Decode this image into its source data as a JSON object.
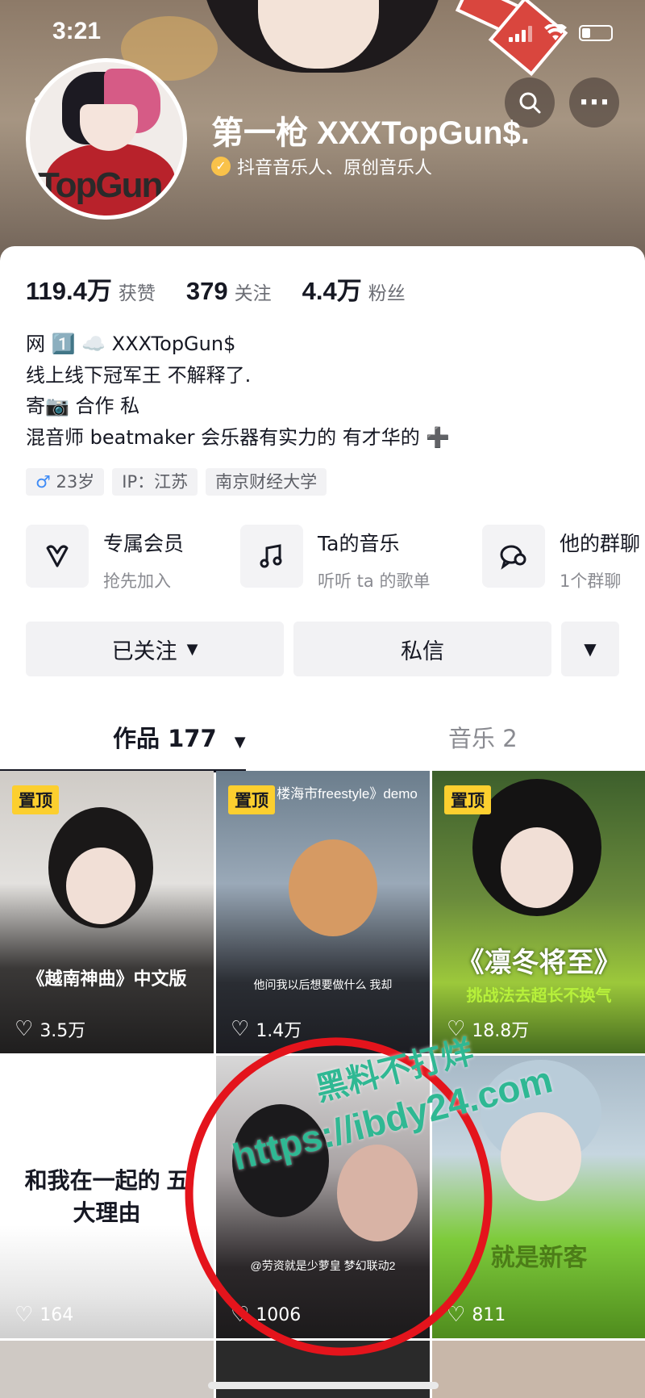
{
  "status_bar": {
    "time": "3:21"
  },
  "profile": {
    "nickname": "第一枪 XXXTopGun$.",
    "verification": "抖音音乐人、原创音乐人",
    "avatar_text": "TopGun"
  },
  "stats": [
    {
      "value": "119.4万",
      "label": "获赞"
    },
    {
      "value": "379",
      "label": "关注"
    },
    {
      "value": "4.4万",
      "label": "粉丝"
    }
  ],
  "bio": [
    "网 1️⃣ ☁️ XXXTopGun$",
    "线上线下冠军王 不解释了.",
    "寄📷 合作 私",
    "混音师 beatmaker 会乐器有实力的 有才华的 ➕"
  ],
  "tags": {
    "age": "23岁",
    "ip": "IP：江苏",
    "school": "南京财经大学"
  },
  "features": [
    {
      "icon": "heart-v-icon",
      "title": "专属会员",
      "subtitle": "抢先加入"
    },
    {
      "icon": "music-note-icon",
      "title": "Ta的音乐",
      "subtitle": "听听 ta 的歌单"
    },
    {
      "icon": "group-chat-icon",
      "title": "他的群聊",
      "subtitle": "1个群聊"
    }
  ],
  "actions": {
    "follow": "已关注",
    "message": "私信"
  },
  "tabs": {
    "works": "作品 177",
    "music": "音乐 2"
  },
  "pin_label": "置顶",
  "videos": [
    {
      "likes": "3.5万",
      "pinned": true,
      "caption": "《越南神曲》中文版"
    },
    {
      "likes": "1.4万",
      "pinned": true,
      "caption": "楼海市freestyle》demo",
      "subtitle": "他问我以后想要做什么 我却"
    },
    {
      "likes": "18.8万",
      "pinned": true,
      "caption": "《凛冬将至》",
      "subtitle": "挑战法去超长不换气"
    },
    {
      "likes": "164",
      "pinned": false,
      "caption": "和我在一起的 五大理由"
    },
    {
      "likes": "1006",
      "pinned": false,
      "subtitle": "@劳资就是少萝皇 梦幻联动2"
    },
    {
      "likes": "811",
      "pinned": false,
      "caption": "就是新客"
    }
  ],
  "watermark": {
    "line1": "黑料不打烊",
    "line2": "https://ibdy24.com"
  },
  "colors": {
    "pin": "#fccf2f",
    "verify": "#f9c24a",
    "scrawl": "#e4141c",
    "watermark": "#2fb893"
  }
}
